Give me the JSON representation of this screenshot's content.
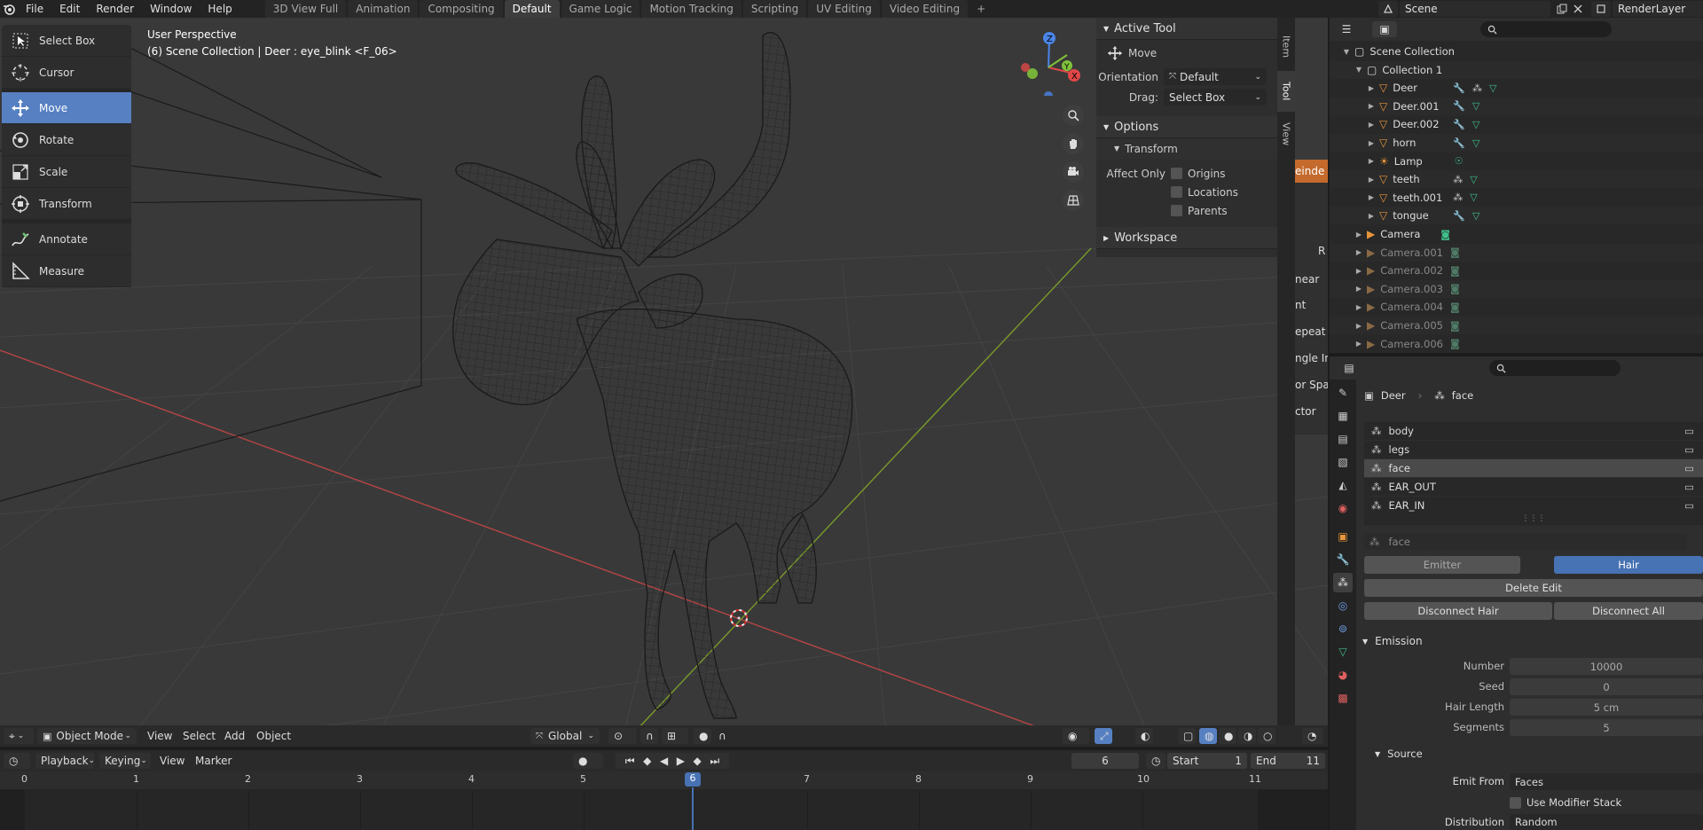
{
  "topbar": {
    "menus": [
      "File",
      "Edit",
      "Render",
      "Window",
      "Help"
    ],
    "workspaces": [
      "3D View Full",
      "Animation",
      "Compositing",
      "Default",
      "Game Logic",
      "Motion Tracking",
      "Scripting",
      "UV Editing",
      "Video Editing"
    ],
    "active_workspace": "Default",
    "add_workspace": "+",
    "scene_name": "Scene",
    "render_layer": "RenderLayer"
  },
  "toolbar": {
    "tools": [
      {
        "label": "Select Box",
        "icon": "select-box-icon"
      },
      {
        "label": "Cursor",
        "icon": "cursor-icon"
      },
      {
        "label": "Move",
        "icon": "move-icon",
        "active": true
      },
      {
        "label": "Rotate",
        "icon": "rotate-icon"
      },
      {
        "label": "Scale",
        "icon": "scale-icon"
      },
      {
        "label": "Transform",
        "icon": "transform-icon"
      },
      {
        "label": "Annotate",
        "icon": "annotate-icon"
      },
      {
        "label": "Measure",
        "icon": "measure-icon"
      }
    ]
  },
  "viewport": {
    "perspective": "User Perspective",
    "context": "(6) Scene Collection | Deer : eye_blink <F_06>"
  },
  "npanel": {
    "active_tool_title": "Active Tool",
    "tool_name": "Move",
    "orientation_label": "Orientation",
    "orientation_value": "Default",
    "drag_label": "Drag:",
    "drag_value": "Select Box",
    "options_title": "Options",
    "transform_title": "Transform",
    "affect_only_label": "Affect Only",
    "origins": "Origins",
    "locations": "Locations",
    "parents": "Parents",
    "workspace_title": "Workspace",
    "tabs": [
      "Item",
      "Tool",
      "View"
    ]
  },
  "strip": {
    "items": [
      "einde",
      "R",
      "near",
      "nt",
      "epeat",
      "ngle In",
      "or Spa",
      "ctor"
    ]
  },
  "vp_header": {
    "mode": "Object Mode",
    "menus": [
      "View",
      "Select",
      "Add",
      "Object"
    ],
    "orientation": "Global"
  },
  "timeline": {
    "menus": [
      "Playback",
      "Keying",
      "View",
      "Marker"
    ],
    "current_frame": "6",
    "start_label": "Start",
    "start_value": "1",
    "end_label": "End",
    "end_value": "11",
    "frames": [
      "0",
      "1",
      "2",
      "3",
      "4",
      "5",
      "6",
      "7",
      "8",
      "9",
      "10",
      "11"
    ]
  },
  "outliner": {
    "rows": [
      {
        "label": "Scene Collection",
        "indent": 0,
        "icon": "collection-icon"
      },
      {
        "label": "Collection 1",
        "indent": 1,
        "icon": "collection-icon"
      },
      {
        "label": "Deer",
        "indent": 2,
        "icon": "mesh-icon"
      },
      {
        "label": "Deer.001",
        "indent": 2,
        "icon": "mesh-icon"
      },
      {
        "label": "Deer.002",
        "indent": 2,
        "icon": "mesh-icon"
      },
      {
        "label": "horn",
        "indent": 2,
        "icon": "mesh-icon"
      },
      {
        "label": "Lamp",
        "indent": 2,
        "icon": "lamp-icon"
      },
      {
        "label": "teeth",
        "indent": 2,
        "icon": "mesh-icon"
      },
      {
        "label": "teeth.001",
        "indent": 2,
        "icon": "mesh-icon"
      },
      {
        "label": "tongue",
        "indent": 2,
        "icon": "mesh-icon"
      },
      {
        "label": "Camera",
        "indent": 1,
        "icon": "camera-icon"
      },
      {
        "label": "Camera.001",
        "indent": 1,
        "icon": "camera-icon",
        "dim": true
      },
      {
        "label": "Camera.002",
        "indent": 1,
        "icon": "camera-icon",
        "dim": true
      },
      {
        "label": "Camera.003",
        "indent": 1,
        "icon": "camera-icon",
        "dim": true
      },
      {
        "label": "Camera.004",
        "indent": 1,
        "icon": "camera-icon",
        "dim": true
      },
      {
        "label": "Camera.005",
        "indent": 1,
        "icon": "camera-icon",
        "dim": true
      },
      {
        "label": "Camera.006",
        "indent": 1,
        "icon": "camera-icon",
        "dim": true
      }
    ]
  },
  "properties": {
    "breadcrumb_object": "Deer",
    "breadcrumb_system": "face",
    "particle_list": [
      "body",
      "legs",
      "face",
      "EAR_OUT",
      "EAR_IN"
    ],
    "selected_particle": "face",
    "settings_name": "face",
    "type_emitter": "Emitter",
    "type_hair": "Hair",
    "delete_edit": "Delete Edit",
    "disconnect_hair": "Disconnect Hair",
    "disconnect_all": "Disconnect All",
    "emission_title": "Emission",
    "number_label": "Number",
    "number_value": "10000",
    "seed_label": "Seed",
    "seed_value": "0",
    "hair_length_label": "Hair Length",
    "hair_length_value": "5 cm",
    "segments_label": "Segments",
    "segments_value": "5",
    "source_title": "Source",
    "emit_from_label": "Emit From",
    "emit_from_value": "Faces",
    "use_modifier_stack": "Use Modifier Stack",
    "distribution_label": "Distribution",
    "distribution_value": "Random"
  },
  "colors": {
    "accent": "#5680c2",
    "x_axis": "#c04a4a",
    "y_axis": "#7a9a2a",
    "mesh_icon": "#e8953a",
    "green_icon": "#3fbf8a"
  }
}
